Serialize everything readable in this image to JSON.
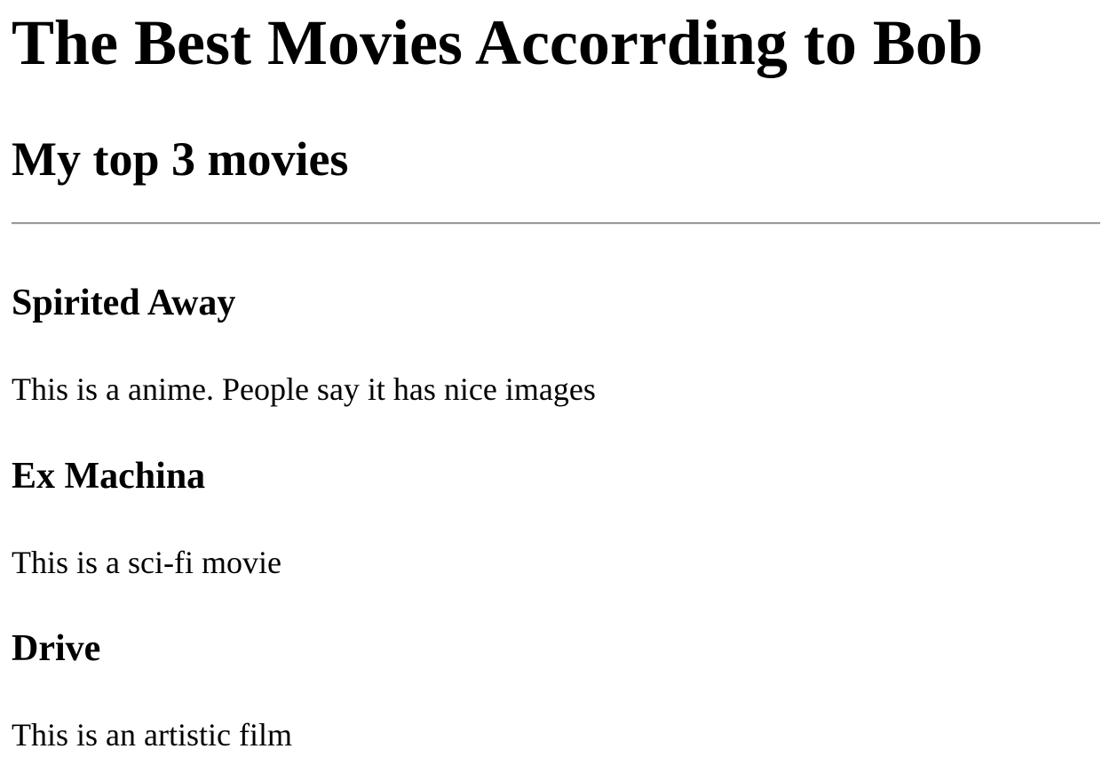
{
  "page": {
    "title": "The Best Movies Accorrding to Bob",
    "subtitle": "My top 3 movies"
  },
  "movies": [
    {
      "title": "Spirited Away",
      "description": "This is a anime. People say it has nice images"
    },
    {
      "title": "Ex Machina",
      "description": "This is a sci-fi movie"
    },
    {
      "title": "Drive",
      "description": "This is an artistic film"
    }
  ]
}
